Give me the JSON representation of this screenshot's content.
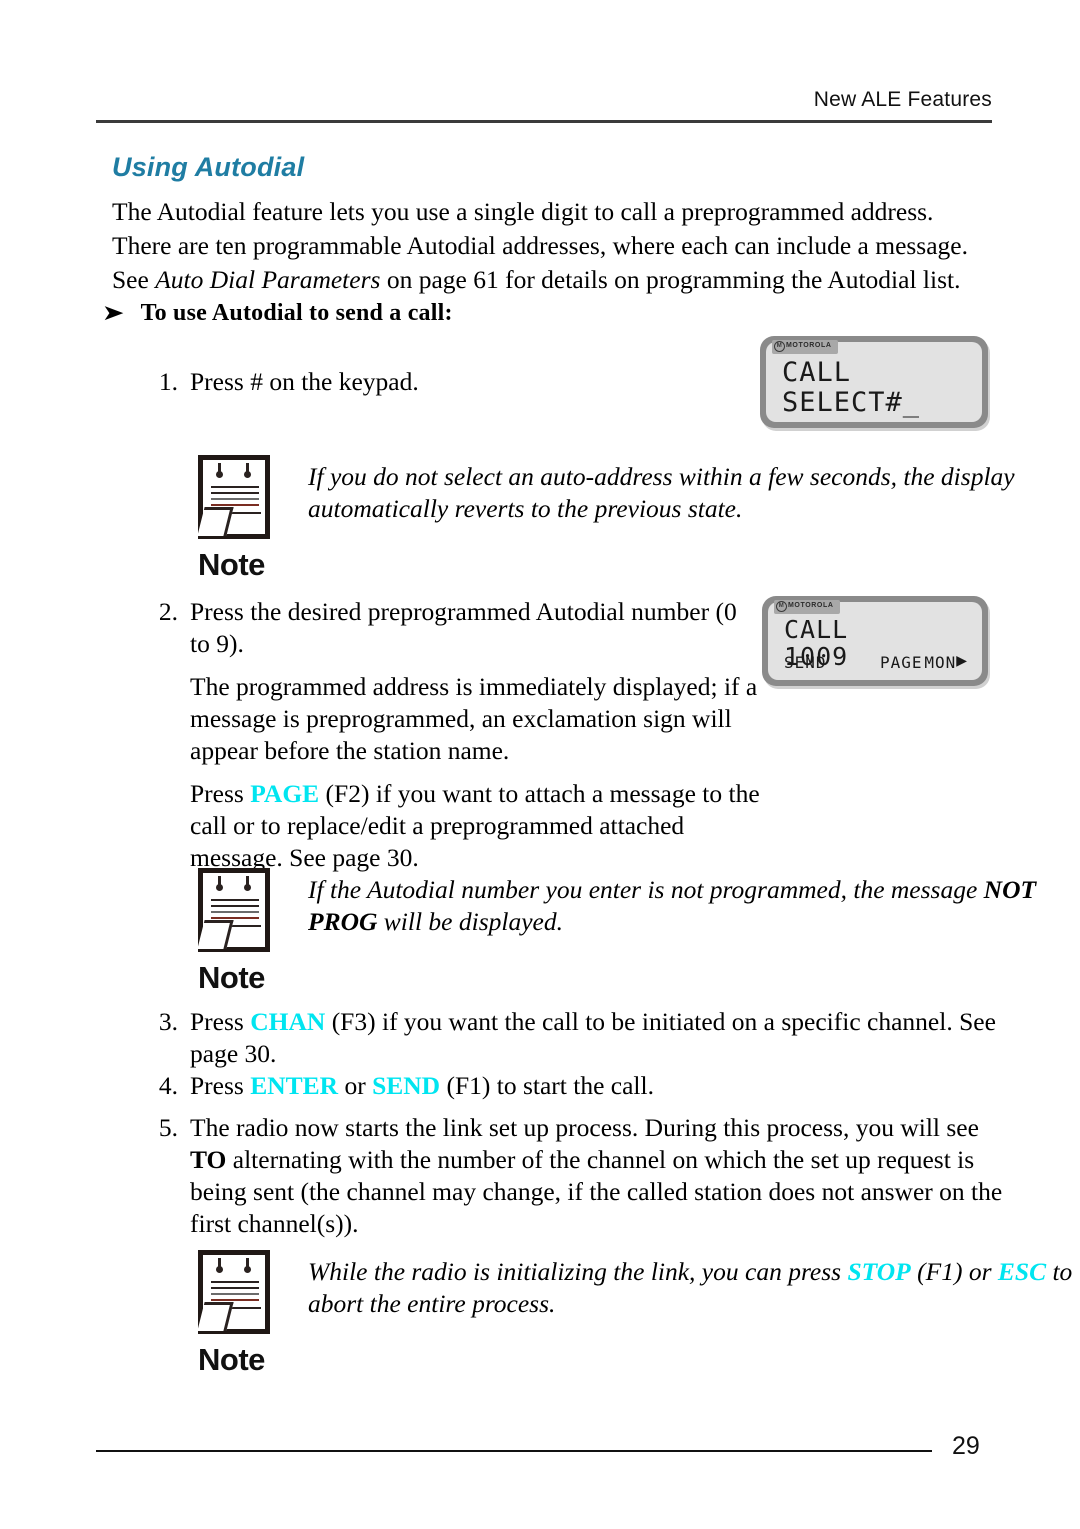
{
  "header": {
    "title": "New ALE Features"
  },
  "section": {
    "title": "Using Autodial"
  },
  "intro": {
    "line1": "The Autodial feature lets you use a single digit to call a preprogrammed address.",
    "line2": "There are ten programmable Autodial addresses, where each can include a message.",
    "line3_pre": "See ",
    "line3_italic": "Auto Dial Parameters",
    "line3_post": " on page 61 for details on programming the Autodial list."
  },
  "procedure": {
    "arrow_icon": "right-arrow-bullet",
    "heading": "To use Autodial to send a call:",
    "steps": [
      {
        "num": "1.",
        "paragraphs": [
          {
            "text": "Press # on the keypad."
          }
        ]
      },
      {
        "num": "2.",
        "paragraphs": [
          {
            "text": "Press the desired preprogrammed Autodial number (0 to 9)."
          },
          {
            "text": "The programmed address is immediately displayed; if a message is preprogrammed, an exclamation sign will appear before the station name."
          },
          {
            "pre": "Press ",
            "key": "PAGE",
            "post": " (F2) if you want to attach a message to the call or to replace/edit a preprogrammed attached message. See page 30."
          }
        ]
      },
      {
        "num": "3.",
        "paragraphs": [
          {
            "pre": "Press ",
            "key": "CHAN",
            "post": " (F3) if you want the call to be initiated on a specific channel. See page 30."
          }
        ]
      },
      {
        "num": "4.",
        "paragraphs": [
          {
            "pre": "Press ",
            "key": "ENTER",
            "mid": " or ",
            "key2": "SEND",
            "post": " (F1) to start the call."
          }
        ]
      },
      {
        "num": "5.",
        "paragraphs": [
          {
            "pre": "The radio now starts the link set up process. During this process, you will see ",
            "bold": "TO",
            "post": " alternating with the number of the channel on which the set up request is being sent (the channel may change, if the called station does not answer on the first channel(s))."
          }
        ]
      }
    ]
  },
  "notes": [
    {
      "icon": "note-document-icon",
      "label": "Note",
      "text": "If you do not select an auto-address within a few seconds, the display automatically reverts to the previous state."
    },
    {
      "icon": "note-document-icon",
      "label": "Note",
      "text_pre": "If the Autodial number you enter is not programmed, the message ",
      "text_bold": "NOT PROG",
      "text_post": " will be displayed."
    },
    {
      "icon": "note-document-icon",
      "label": "Note",
      "text_pre": "While the radio is initializing the link, you can press ",
      "key": "STOP",
      "text_mid": " (F1) or ",
      "key2": "ESC",
      "text_post": " to abort the entire process."
    }
  ],
  "lcd_displays": [
    {
      "brand_icon": "motorola-m-icon",
      "brand": "MOTOROLA",
      "line1": "CALL",
      "line2": "SELECT#_",
      "softkeys": null
    },
    {
      "brand_icon": "motorola-m-icon",
      "brand": "MOTOROLA",
      "line1": "CALL",
      "line2": "1009",
      "softkeys": {
        "f1": "SEND",
        "f2": "PAGE",
        "f3": "MON",
        "arrow_icon": "right-triangle-icon",
        "arrow": "▶"
      }
    }
  ],
  "footer": {
    "page_number": "29"
  },
  "colors": {
    "heading_teal": "#1f7da3",
    "key_cyan": "#00e5f0",
    "rule_dark": "#3b3b3b"
  }
}
